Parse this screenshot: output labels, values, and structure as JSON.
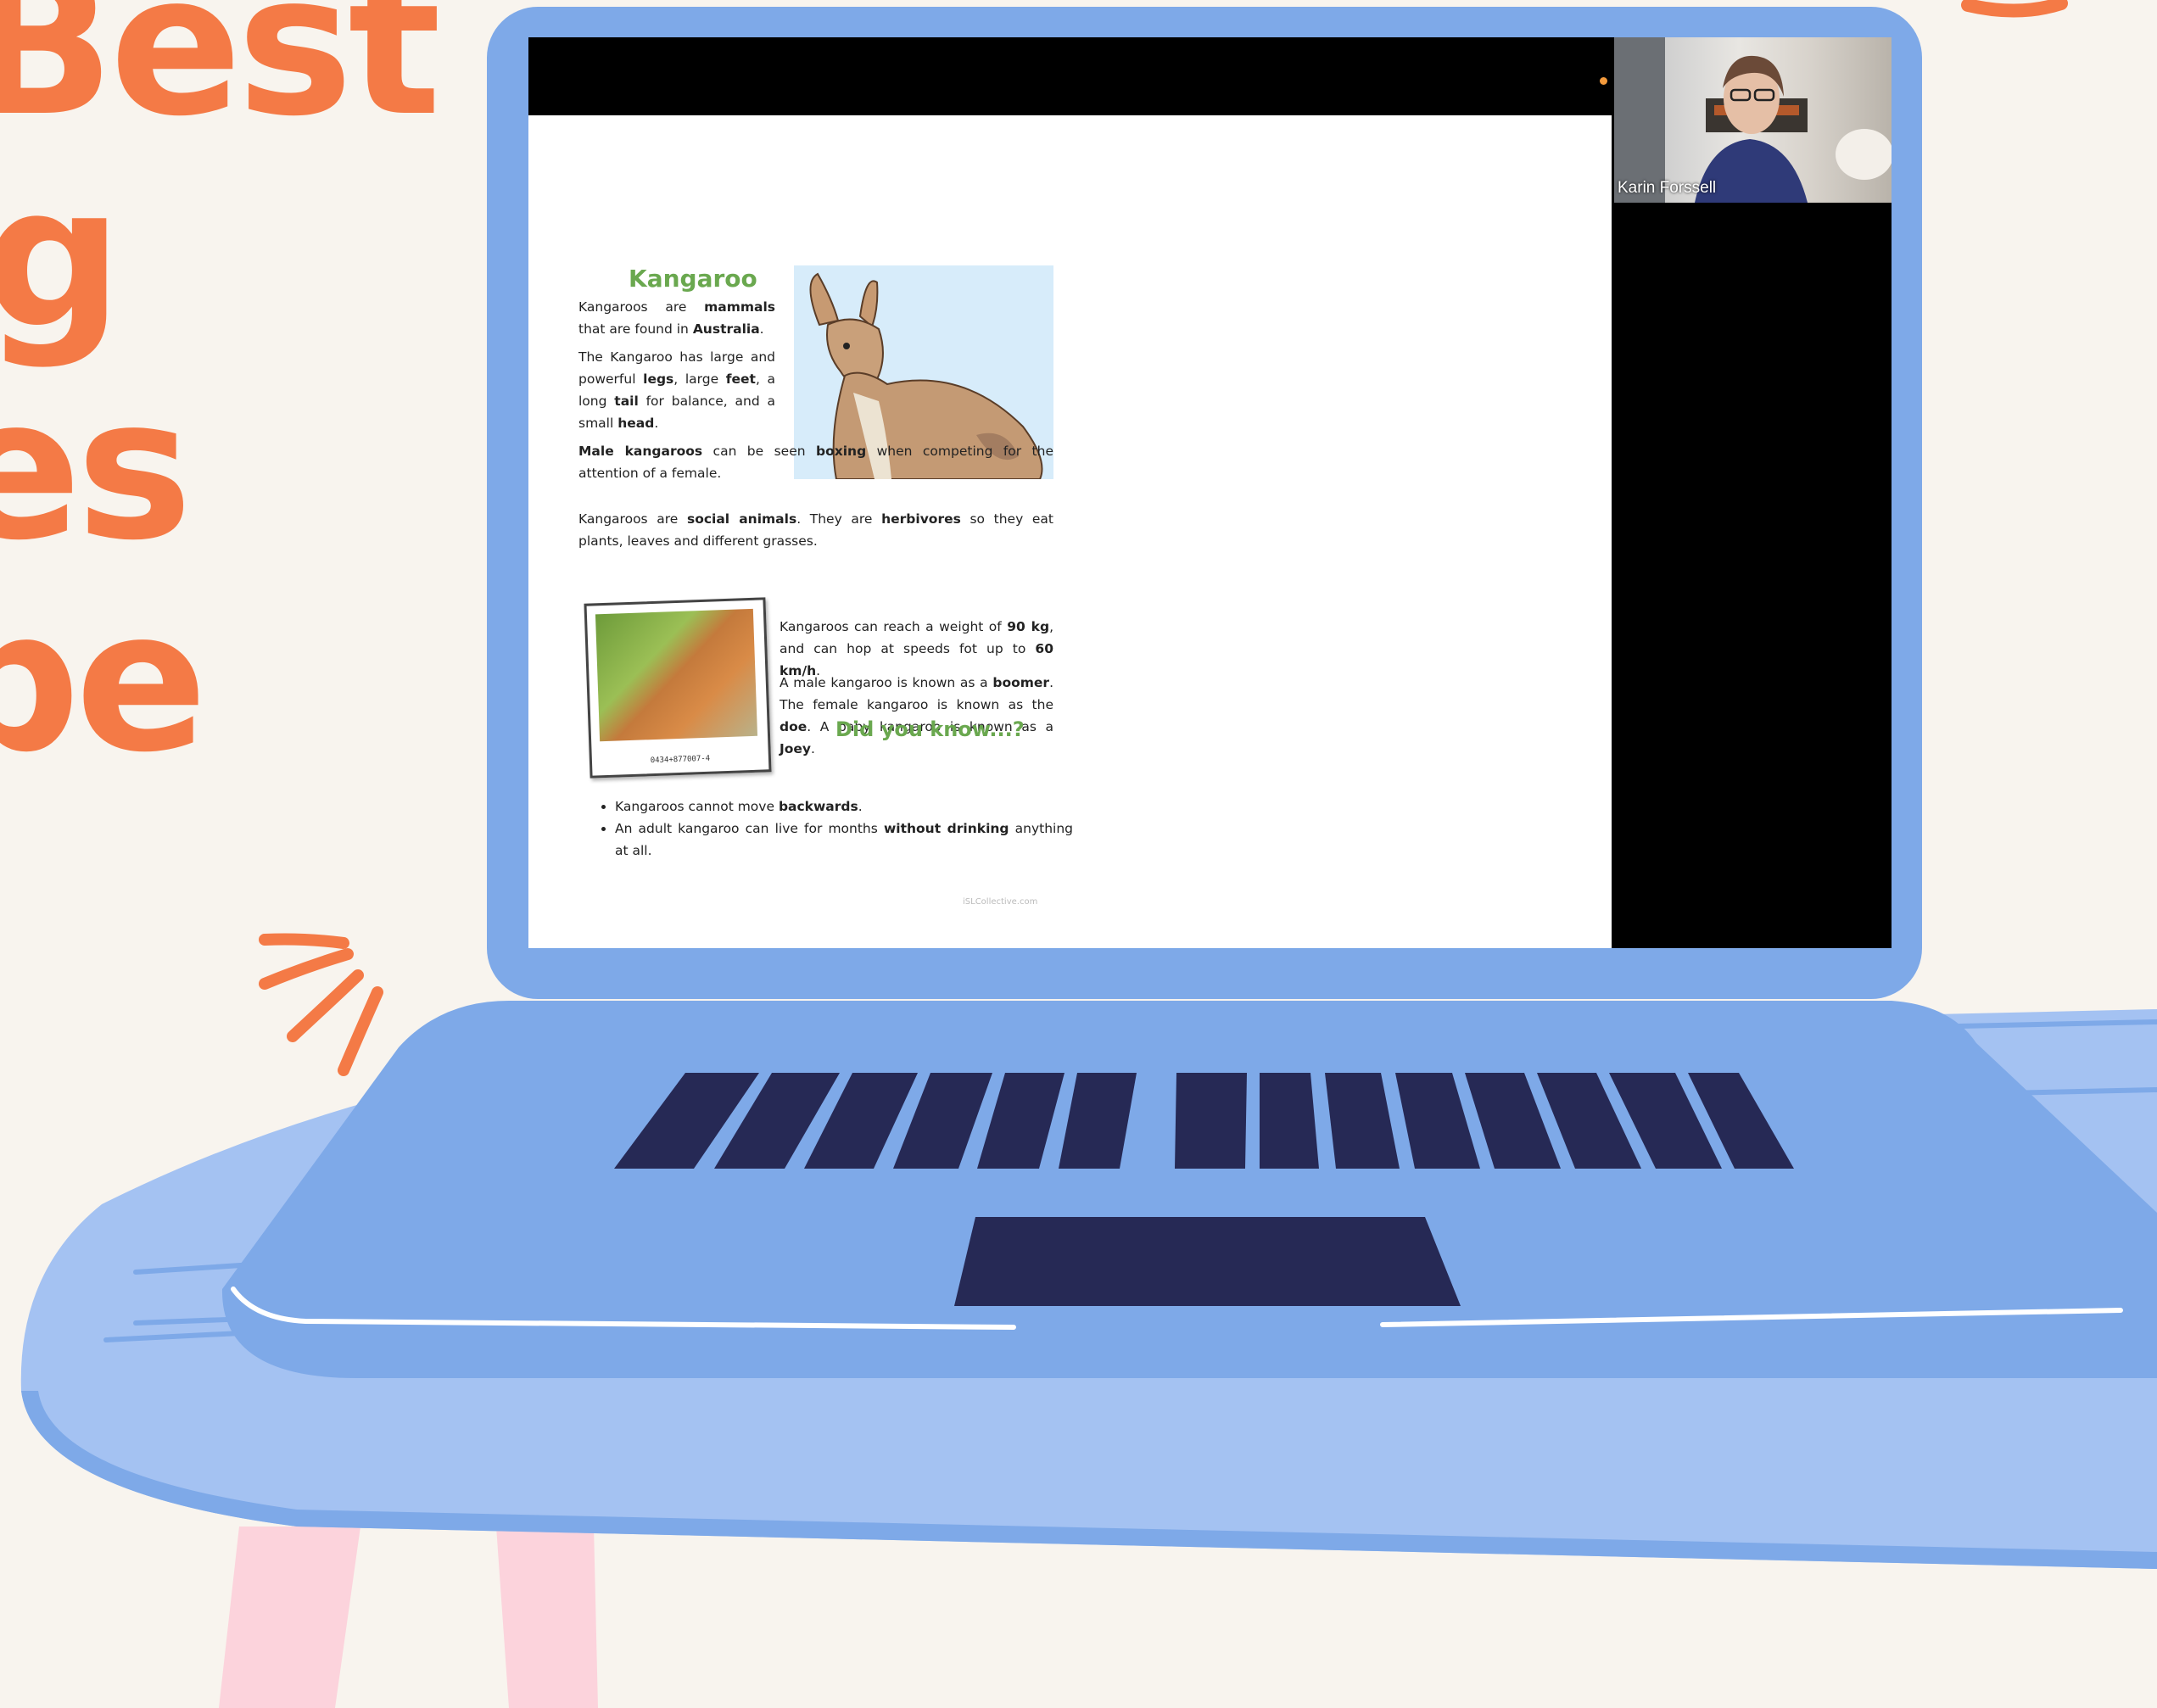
{
  "headline": {
    "line1": "Best",
    "line2": "g",
    "line3": "es",
    "line4": "pe"
  },
  "video_call": {
    "participant_name": "Karin Forssell"
  },
  "worksheet": {
    "title": "Kangaroo",
    "para1": [
      "Kangaroos are ",
      "mammals",
      " that are found in ",
      "Australia",
      "."
    ],
    "para2": [
      "The Kangaroo has large and powerful ",
      "legs",
      ", large ",
      "feet",
      ", a long ",
      "tail",
      " for balance, and a small ",
      "head",
      "."
    ],
    "para3": [
      "Male kangaroos",
      " can be seen ",
      "boxing",
      " when competing for the attention of a female."
    ],
    "para4": [
      "Kangaroos are ",
      "social animals",
      ". They are ",
      "herbivores",
      " so they eat plants, leaves and different grasses."
    ],
    "para5": [
      "Kangaroos can reach a weight of ",
      "90 kg",
      ", and can hop at speeds fot up to ",
      "60 km/h",
      "."
    ],
    "para6": [
      "A male kangaroo is known as a ",
      "boomer",
      ". The female kangaroo is known as the ",
      "doe",
      ". A baby kangaroo is known as a ",
      "Joey",
      "."
    ],
    "photo_caption": "0434+877007-4",
    "did_you_know_title": "Did you know...?",
    "fact1": [
      "Kangaroos cannot move ",
      "backwards",
      "."
    ],
    "fact2": [
      "An adult kangaroo can live for months ",
      "without drinking",
      " anything at all."
    ],
    "watermark": "iSLCollective.com"
  },
  "colors": {
    "background": "#f8f4ee",
    "accent_orange": "#f47a46",
    "laptop_blue": "#7ea9e8",
    "keys_navy": "#262955",
    "table_blue": "#a4c2f2",
    "table_legs_pink": "#fcd3dc",
    "title_green": "#6aa84f"
  }
}
